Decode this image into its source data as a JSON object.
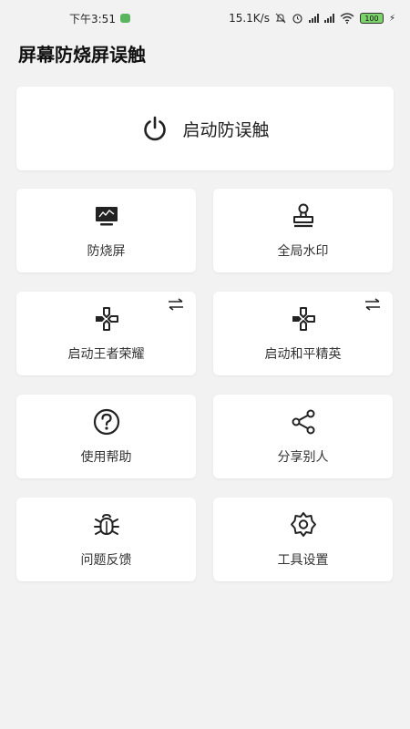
{
  "status_bar": {
    "time": "下午3:51",
    "net_speed": "15.1K/s",
    "battery": "100"
  },
  "page": {
    "title": "屏幕防烧屏误触"
  },
  "main_button": {
    "label": "启动防误触",
    "icon": "power-icon"
  },
  "grid": [
    {
      "label": "防烧屏",
      "icon": "monitor-icon"
    },
    {
      "label": "全局水印",
      "icon": "stamp-icon"
    },
    {
      "label": "启动王者荣耀",
      "icon": "gamepad-icon",
      "swap": true
    },
    {
      "label": "启动和平精英",
      "icon": "gamepad-icon",
      "swap": true
    },
    {
      "label": "使用帮助",
      "icon": "help-icon"
    },
    {
      "label": "分享别人",
      "icon": "share-icon"
    },
    {
      "label": "问题反馈",
      "icon": "bug-icon"
    },
    {
      "label": "工具设置",
      "icon": "gear-icon"
    }
  ],
  "colors": {
    "background": "#f2f2f2",
    "card": "#ffffff",
    "icon": "#333333"
  }
}
